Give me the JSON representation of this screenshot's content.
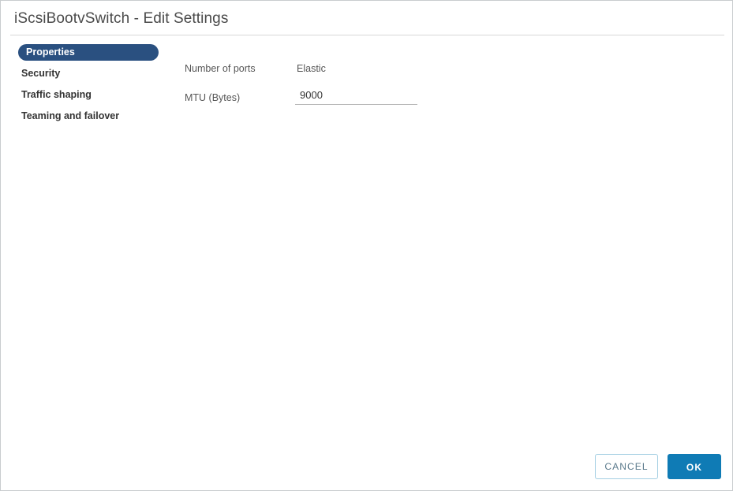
{
  "dialog": {
    "title": "iScsiBootvSwitch - Edit Settings"
  },
  "sidebar": {
    "items": [
      {
        "label": "Properties",
        "selected": true
      },
      {
        "label": "Security",
        "selected": false
      },
      {
        "label": "Traffic shaping",
        "selected": false
      },
      {
        "label": "Teaming and failover",
        "selected": false
      }
    ]
  },
  "form": {
    "number_of_ports": {
      "label": "Number of ports",
      "value": "Elastic"
    },
    "mtu": {
      "label": "MTU (Bytes)",
      "value": "9000",
      "placeholder": "9000"
    }
  },
  "footer": {
    "cancel_label": "CANCEL",
    "ok_label": "OK"
  },
  "colors": {
    "selected_nav_bg": "#2a5080",
    "primary_button_bg": "#0f7bb5",
    "cancel_button_border": "#a4cfe3",
    "cancel_button_text": "#5b7a8c",
    "label_text": "#565656",
    "nav_text": "#333333"
  }
}
